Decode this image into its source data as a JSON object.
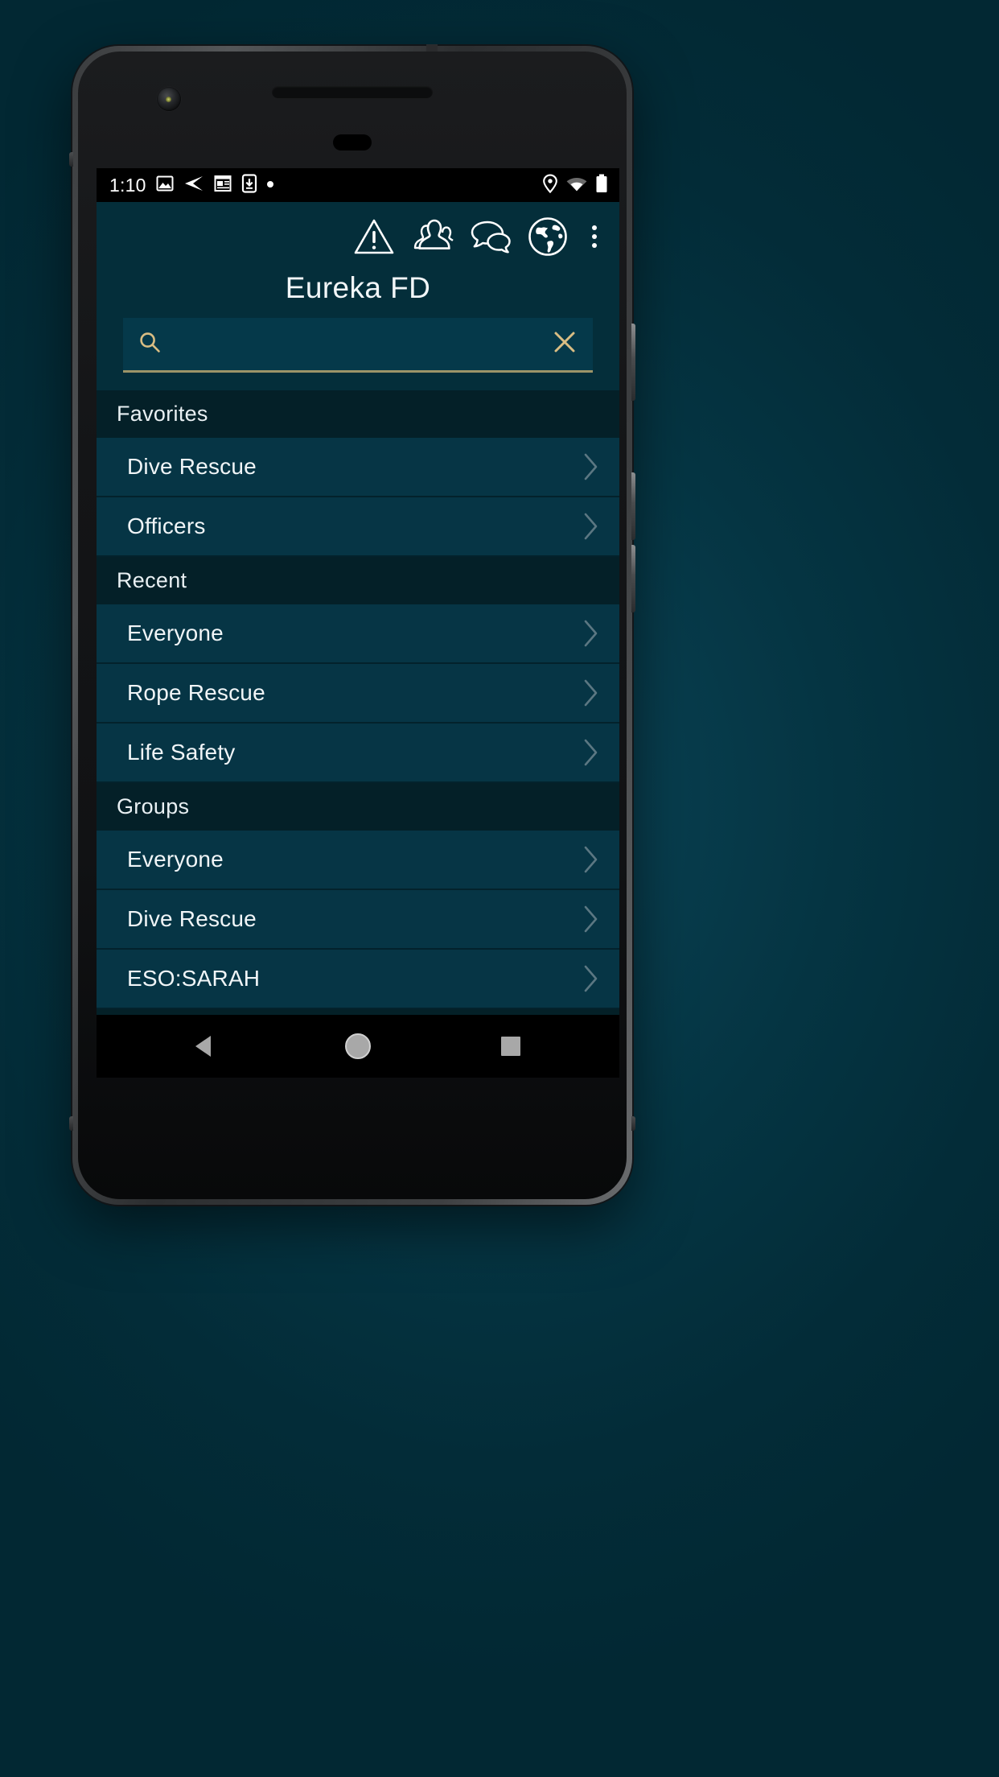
{
  "device": {
    "frame_color": "#3e4042",
    "backdrop_color": "#04303d"
  },
  "status_bar": {
    "time": "1:10",
    "left_icons": [
      {
        "name": "image-icon"
      },
      {
        "name": "send-icon"
      },
      {
        "name": "news-icon"
      },
      {
        "name": "download-to-phone-icon"
      },
      {
        "name": "more-notifications-dot-icon"
      }
    ],
    "right_icons": [
      {
        "name": "location-pin-icon"
      },
      {
        "name": "wifi-icon"
      },
      {
        "name": "battery-icon"
      }
    ]
  },
  "app_bar": {
    "title": "Eureka FD",
    "actions": [
      {
        "name": "alert-icon",
        "label": "Alert"
      },
      {
        "name": "contacts-group-icon",
        "label": "Contacts"
      },
      {
        "name": "chat-bubbles-icon",
        "label": "Messages"
      },
      {
        "name": "globe-icon",
        "label": "Map"
      },
      {
        "name": "overflow-menu-icon",
        "label": "More options"
      }
    ]
  },
  "search": {
    "value": "",
    "placeholder": "",
    "search_icon": "search-icon",
    "clear_icon": "clear-icon",
    "accent_color": "#9c9468",
    "field_background": "#05394a"
  },
  "list": {
    "sections": [
      {
        "header": "Favorites",
        "items": [
          {
            "label": "Dive Rescue",
            "chevron": "chevron-right-icon"
          },
          {
            "label": "Officers",
            "chevron": "chevron-right-icon"
          }
        ]
      },
      {
        "header": "Recent",
        "items": [
          {
            "label": "Everyone",
            "chevron": "chevron-right-icon"
          },
          {
            "label": "Rope Rescue",
            "chevron": "chevron-right-icon"
          },
          {
            "label": "Life Safety",
            "chevron": "chevron-right-icon"
          }
        ]
      },
      {
        "header": "Groups",
        "items": [
          {
            "label": "Everyone",
            "chevron": "chevron-right-icon"
          },
          {
            "label": "Dive Rescue",
            "chevron": "chevron-right-icon"
          },
          {
            "label": "ESO:SARAH",
            "chevron": "chevron-right-icon"
          }
        ]
      }
    ]
  },
  "nav_bar": {
    "buttons": [
      {
        "name": "back-button",
        "icon": "triangle-back-icon"
      },
      {
        "name": "home-button",
        "icon": "circle-home-icon"
      },
      {
        "name": "recents-button",
        "icon": "square-recents-icon"
      }
    ]
  },
  "colors": {
    "app_bar_bg": "#042e3a",
    "page_bg": "#042027",
    "row_bg": "#063545",
    "section_bg": "#042028",
    "text": "#f0f5f7",
    "chevron": "#5b7782"
  }
}
